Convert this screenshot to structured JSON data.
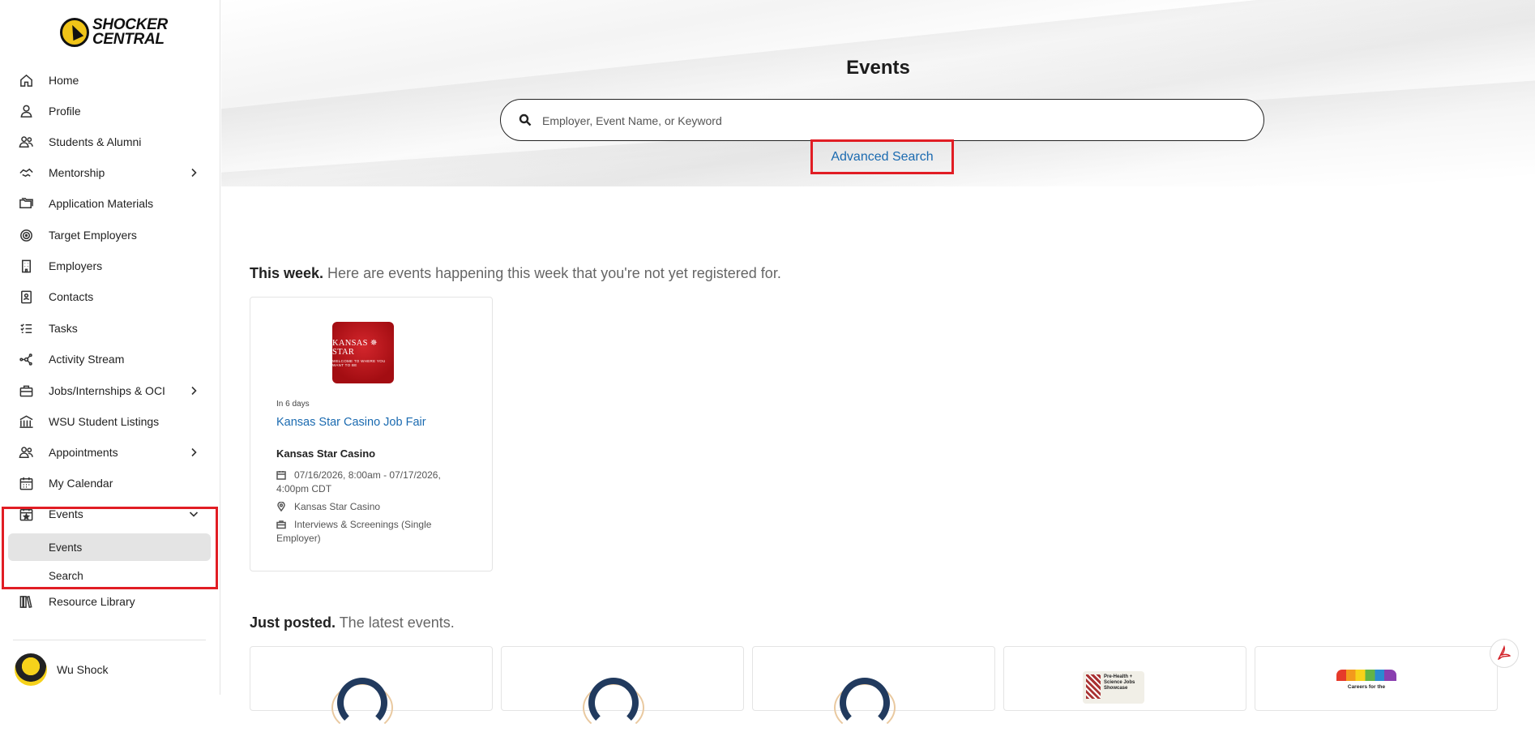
{
  "brand": {
    "line1": "SHOCKER",
    "line2": "CENTRAL"
  },
  "nav": {
    "items": [
      {
        "label": "Home",
        "icon": "home-icon"
      },
      {
        "label": "Profile",
        "icon": "person-icon"
      },
      {
        "label": "Students & Alumni",
        "icon": "people-icon"
      },
      {
        "label": "Mentorship",
        "icon": "handshake-icon"
      },
      {
        "label": "Application Materials",
        "icon": "folders-icon"
      },
      {
        "label": "Target Employers",
        "icon": "target-icon"
      },
      {
        "label": "Employers",
        "icon": "building-icon"
      },
      {
        "label": "Contacts",
        "icon": "contact-book-icon"
      },
      {
        "label": "Tasks",
        "icon": "checklist-icon"
      },
      {
        "label": "Activity Stream",
        "icon": "network-icon"
      },
      {
        "label": "Jobs/Internships & OCI",
        "icon": "briefcase-icon"
      },
      {
        "label": "WSU Student Listings",
        "icon": "institution-icon"
      },
      {
        "label": "Appointments",
        "icon": "people-icon"
      },
      {
        "label": "My Calendar",
        "icon": "calendar-icon"
      },
      {
        "label": "Events",
        "icon": "calendar-star-icon"
      },
      {
        "label": "Resource Library",
        "icon": "books-icon"
      }
    ],
    "events_sub": [
      {
        "label": "Events",
        "active": true
      },
      {
        "label": "Search",
        "active": false
      }
    ]
  },
  "user": {
    "name": "Wu Shock"
  },
  "page": {
    "title": "Events",
    "search_placeholder": "Employer, Event Name, or Keyword",
    "advanced_search": "Advanced Search"
  },
  "this_week": {
    "heading": "This week.",
    "subheading": " Here are events happening this week that you're not yet registered for.",
    "event": {
      "logo_line1": "KANSAS ✵ STAR",
      "logo_line2": "WELCOME TO WHERE YOU WANT TO BE",
      "when": "In 6 days",
      "title": "Kansas Star Casino Job Fair",
      "employer": "Kansas Star Casino",
      "dates": "07/16/2026, 8:00am - 07/17/2026, 4:00pm CDT",
      "location": "Kansas Star Casino",
      "type": "Interviews & Screenings (Single Employer)"
    }
  },
  "just_posted": {
    "heading": "Just posted.",
    "subheading": " The latest events.",
    "thumb_b_text": "Pre-Health + Science Jobs Showcase",
    "thumb_c_text": "Careers for the"
  },
  "colors": {
    "accent_link": "#1a6ab0",
    "highlight_border": "#e11d24"
  }
}
